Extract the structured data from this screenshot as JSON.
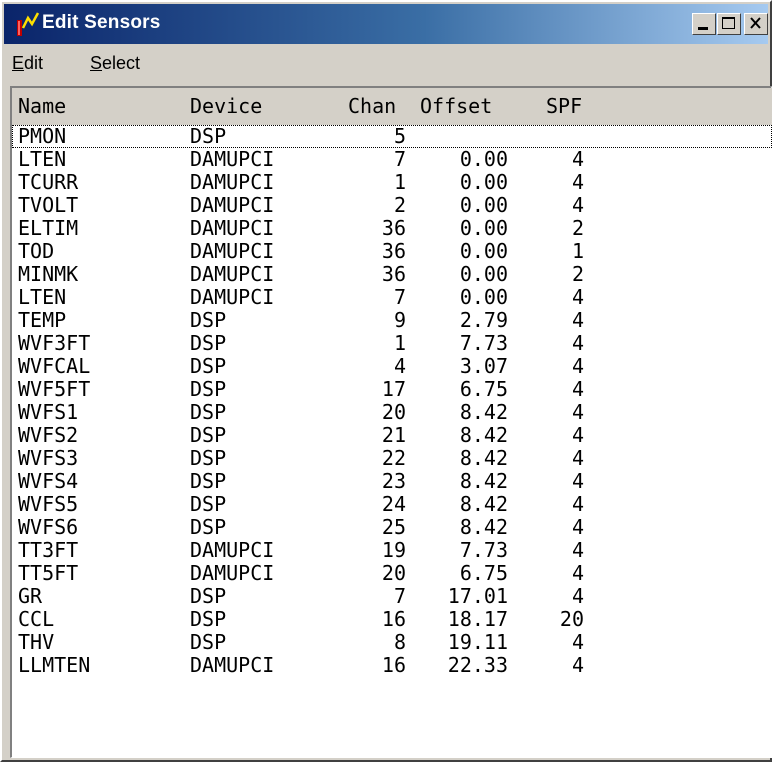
{
  "window": {
    "title": "Edit Sensors"
  },
  "menu": {
    "edit": "Edit",
    "select": "Select"
  },
  "columns": {
    "name": "Name",
    "device": "Device",
    "chan": "Chan",
    "offset": "Offset",
    "spf": "SPF"
  },
  "rows": [
    {
      "name": "PMON",
      "device": "DSP",
      "chan": "5",
      "offset": "",
      "spf": ""
    },
    {
      "name": "LTEN",
      "device": "DAMUPCI",
      "chan": "7",
      "offset": "0.00",
      "spf": "4"
    },
    {
      "name": "TCURR",
      "device": "DAMUPCI",
      "chan": "1",
      "offset": "0.00",
      "spf": "4"
    },
    {
      "name": "TVOLT",
      "device": "DAMUPCI",
      "chan": "2",
      "offset": "0.00",
      "spf": "4"
    },
    {
      "name": "ELTIM",
      "device": "DAMUPCI",
      "chan": "36",
      "offset": "0.00",
      "spf": "2"
    },
    {
      "name": "TOD",
      "device": "DAMUPCI",
      "chan": "36",
      "offset": "0.00",
      "spf": "1"
    },
    {
      "name": "MINMK",
      "device": "DAMUPCI",
      "chan": "36",
      "offset": "0.00",
      "spf": "2"
    },
    {
      "name": "LTEN",
      "device": "DAMUPCI",
      "chan": "7",
      "offset": "0.00",
      "spf": "4"
    },
    {
      "name": "TEMP",
      "device": "DSP",
      "chan": "9",
      "offset": "2.79",
      "spf": "4"
    },
    {
      "name": "WVF3FT",
      "device": "DSP",
      "chan": "1",
      "offset": "7.73",
      "spf": "4"
    },
    {
      "name": "WVFCAL",
      "device": "DSP",
      "chan": "4",
      "offset": "3.07",
      "spf": "4"
    },
    {
      "name": "WVF5FT",
      "device": "DSP",
      "chan": "17",
      "offset": "6.75",
      "spf": "4"
    },
    {
      "name": "WVFS1",
      "device": "DSP",
      "chan": "20",
      "offset": "8.42",
      "spf": "4"
    },
    {
      "name": "WVFS2",
      "device": "DSP",
      "chan": "21",
      "offset": "8.42",
      "spf": "4"
    },
    {
      "name": "WVFS3",
      "device": "DSP",
      "chan": "22",
      "offset": "8.42",
      "spf": "4"
    },
    {
      "name": "WVFS4",
      "device": "DSP",
      "chan": "23",
      "offset": "8.42",
      "spf": "4"
    },
    {
      "name": "WVFS5",
      "device": "DSP",
      "chan": "24",
      "offset": "8.42",
      "spf": "4"
    },
    {
      "name": "WVFS6",
      "device": "DSP",
      "chan": "25",
      "offset": "8.42",
      "spf": "4"
    },
    {
      "name": "TT3FT",
      "device": "DAMUPCI",
      "chan": "19",
      "offset": "7.73",
      "spf": "4"
    },
    {
      "name": "TT5FT",
      "device": "DAMUPCI",
      "chan": "20",
      "offset": "6.75",
      "spf": "4"
    },
    {
      "name": "GR",
      "device": "DSP",
      "chan": "7",
      "offset": "17.01",
      "spf": "4"
    },
    {
      "name": "CCL",
      "device": "DSP",
      "chan": "16",
      "offset": "18.17",
      "spf": "20"
    },
    {
      "name": "THV",
      "device": "DSP",
      "chan": "8",
      "offset": "19.11",
      "spf": "4"
    },
    {
      "name": "LLMTEN",
      "device": "DAMUPCI",
      "chan": "16",
      "offset": "22.33",
      "spf": "4"
    }
  ],
  "selected_row": 0,
  "icons": [
    "app-icon",
    "minimize-icon",
    "maximize-icon",
    "close-icon"
  ],
  "colors": {
    "titlebar_start": "#0a246a",
    "titlebar_end": "#a6caf0",
    "face": "#d4d0c8"
  }
}
